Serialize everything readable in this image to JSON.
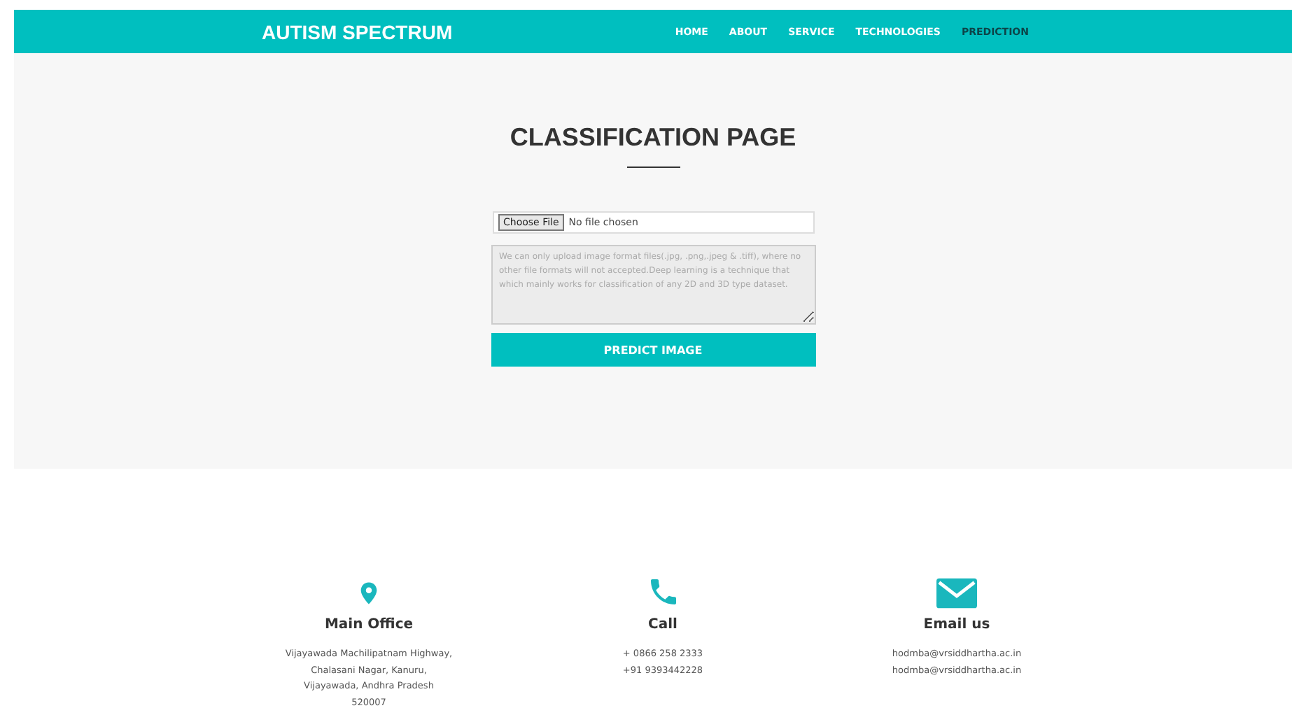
{
  "header": {
    "brand": "AUTISM SPECTRUM",
    "nav": [
      {
        "label": "HOME",
        "selected": false
      },
      {
        "label": "ABOUT",
        "selected": false
      },
      {
        "label": "SERVICE",
        "selected": false
      },
      {
        "label": "TECHNOLOGIES",
        "selected": false
      },
      {
        "label": "PREDICTION",
        "selected": true
      }
    ]
  },
  "main": {
    "title": "CLASSIFICATION PAGE",
    "file_button": "Choose File",
    "file_status": "No file chosen",
    "textarea": {
      "placeholder": "We can only upload image format files(.jpg, .png,.jpeg & .tiff), where no other file formats will not accepted.Deep learning is a technique that which mainly works for classification of any 2D and 3D type dataset."
    },
    "submit": "PREDICT IMAGE"
  },
  "contacts": [
    {
      "kind": "pin",
      "title": "Main Office",
      "lines": [
        "Vijayawada Machilipatnam Highway,",
        "Chalasani Nagar, Kanuru,",
        "Vijayawada, Andhra Pradesh",
        "520007"
      ]
    },
    {
      "kind": "phone",
      "title": "Call",
      "lines": [
        "+ 0866 258 2333",
        "+91 9393442228"
      ]
    },
    {
      "kind": "mail",
      "title": "Email us",
      "lines": [
        "hodmba@vrsiddhartha.ac.in",
        "hodmba@vrsiddhartha.ac.in"
      ]
    }
  ]
}
